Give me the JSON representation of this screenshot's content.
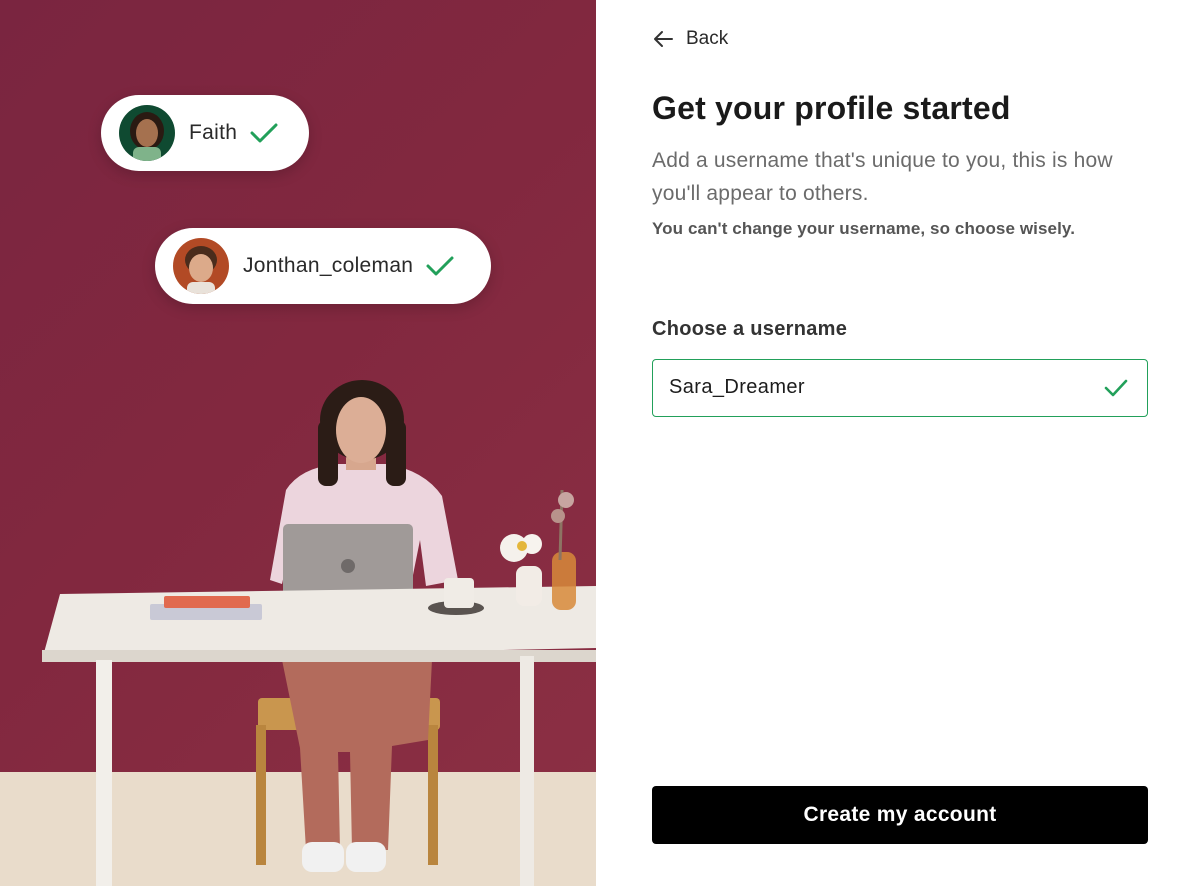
{
  "photo": {
    "description_icon": "woman-at-laptop-photo",
    "user_tags": [
      {
        "name": "Faith",
        "status_icon": "check-icon"
      },
      {
        "name": "Jonthan_coleman",
        "status_icon": "check-icon"
      }
    ]
  },
  "nav": {
    "back_label": "Back",
    "back_icon": "arrow-left-icon"
  },
  "heading": {
    "title": "Get your profile started",
    "description": "Add a username that's unique to you, this is how you'll appear to others.",
    "warning": "You can't change your username, so choose wisely."
  },
  "form": {
    "username_label": "Choose a username",
    "username_value": "Sara_Dreamer",
    "valid_icon": "check-icon"
  },
  "actions": {
    "submit_label": "Create my account"
  },
  "colors": {
    "accent": "#22a05a",
    "button": "#000000",
    "backdrop": "#82283f"
  }
}
